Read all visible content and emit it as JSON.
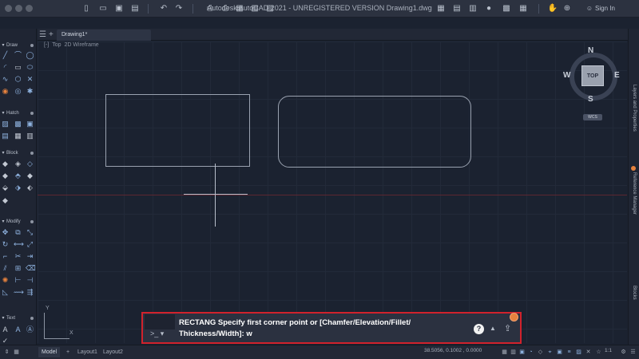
{
  "window": {
    "title": "Autodesk AutoCAD 2021 - UNREGISTERED VERSION    Drawing1.dwg",
    "sign_in": "Sign In"
  },
  "tabs": {
    "new_tab": "+",
    "active": "Drawing1*"
  },
  "viewport": {
    "controls": "[-]",
    "view": "Top",
    "style": "2D Wireframe"
  },
  "viewcube": {
    "top_face": "TOP",
    "north": "N",
    "south": "S",
    "east": "E",
    "west": "W",
    "wcs": "WCS"
  },
  "palette": {
    "sections": [
      "Draw",
      "Hatch",
      "Block",
      "Modify",
      "Text"
    ]
  },
  "right_panels": [
    "Layers and Properties",
    "Reference Manager",
    "Blocks"
  ],
  "ucs": {
    "x": "X",
    "y": "Y"
  },
  "command_line": {
    "prompt_symbol": ">_",
    "text": "RECTANG Specify first corner point or [Chamfer/Elevation/Fillet/ Thickness/Width]: w",
    "help": "?"
  },
  "status": {
    "tabs": [
      "Model",
      "Layout1",
      "Layout2"
    ],
    "add_layout": "+",
    "coordinates": "38.5056, 0.1002 , 0.0000",
    "scale": "1:1"
  },
  "colors": {
    "accent_orange": "#e6823e",
    "highlight_red": "#d1222c",
    "canvas": "#1b2230"
  }
}
